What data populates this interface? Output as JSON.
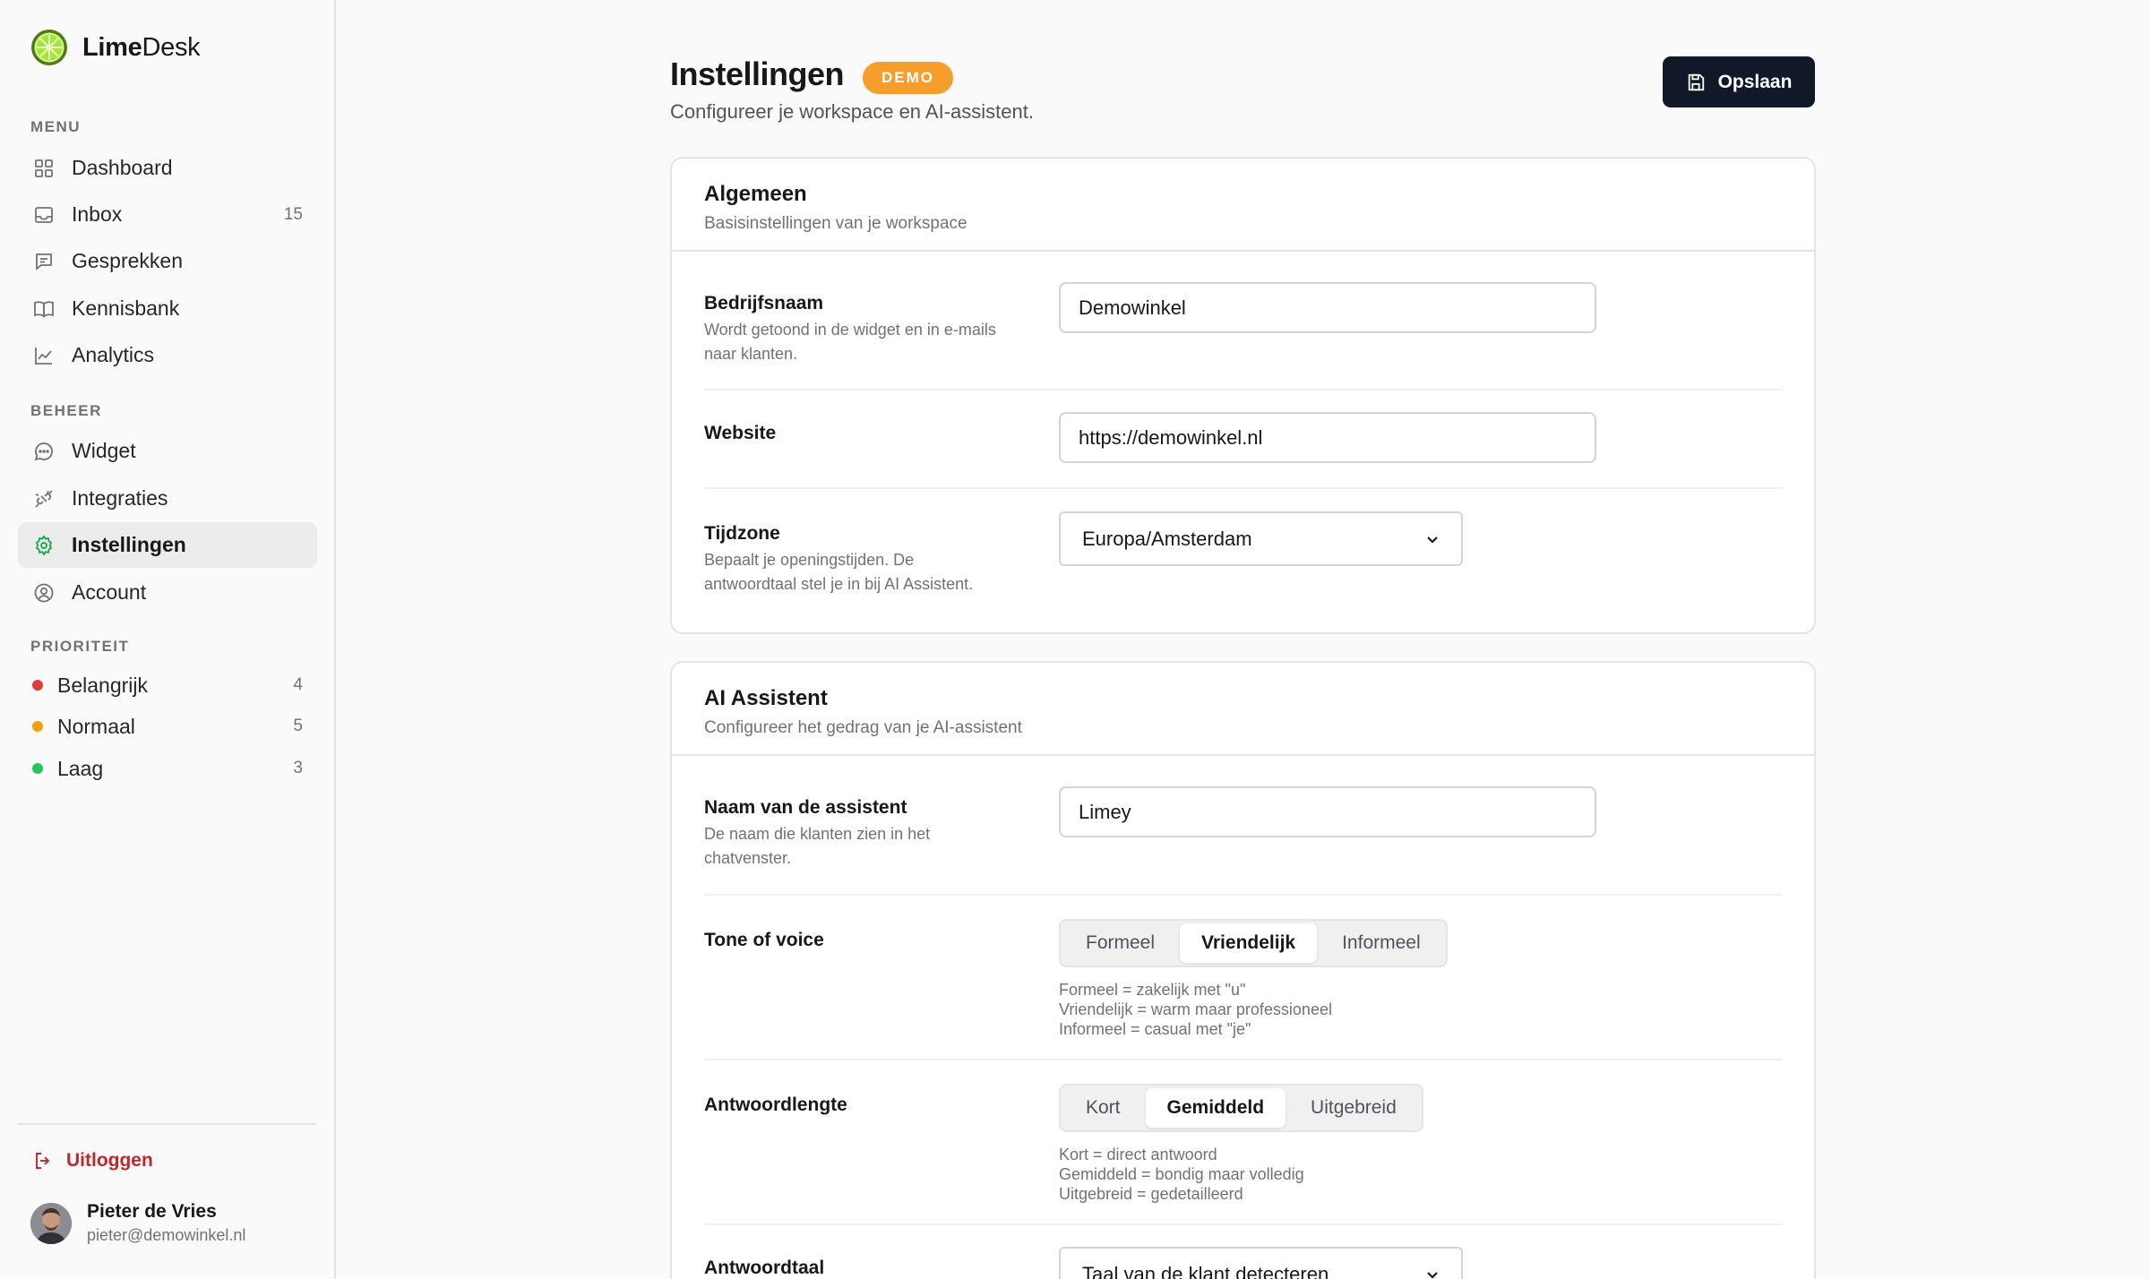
{
  "brand": {
    "name_bold": "Lime",
    "name_rest": "Desk"
  },
  "sidebar": {
    "menu_label": "MENU",
    "menu_items": [
      {
        "label": "Dashboard",
        "icon": "grid-icon",
        "count": ""
      },
      {
        "label": "Inbox",
        "icon": "inbox-icon",
        "count": "15"
      },
      {
        "label": "Gesprekken",
        "icon": "message-icon",
        "count": ""
      },
      {
        "label": "Kennisbank",
        "icon": "book-icon",
        "count": ""
      },
      {
        "label": "Analytics",
        "icon": "chart-icon",
        "count": ""
      }
    ],
    "beheer_label": "BEHEER",
    "beheer_items": [
      {
        "label": "Widget",
        "icon": "chat-bubble-icon"
      },
      {
        "label": "Integraties",
        "icon": "plug-icon"
      },
      {
        "label": "Instellingen",
        "icon": "gear-icon",
        "active": true
      },
      {
        "label": "Account",
        "icon": "user-circle-icon"
      }
    ],
    "priority_label": "PRIORITEIT",
    "priority_items": [
      {
        "label": "Belangrijk",
        "count": "4",
        "color": "#e03a3a"
      },
      {
        "label": "Normaal",
        "count": "5",
        "color": "#f59e0b"
      },
      {
        "label": "Laag",
        "count": "3",
        "color": "#22c55e"
      }
    ],
    "logout_label": "Uitloggen",
    "user": {
      "name": "Pieter de Vries",
      "email": "pieter@demowinkel.nl"
    }
  },
  "header": {
    "title": "Instellingen",
    "badge": "DEMO",
    "subtitle": "Configureer je workspace en AI-assistent.",
    "save_label": "Opslaan"
  },
  "general": {
    "title": "Algemeen",
    "description": "Basisinstellingen van je workspace",
    "company_label": "Bedrijfsnaam",
    "company_hint": "Wordt getoond in de widget en in e-mails naar klanten.",
    "company_value": "Demowinkel",
    "website_label": "Website",
    "website_value": "https://demowinkel.nl",
    "timezone_label": "Tijdzone",
    "timezone_hint": "Bepaalt je openingstijden. De antwoordtaal stel je in bij AI Assistent.",
    "timezone_value": "Europa/Amsterdam"
  },
  "assistant": {
    "title": "AI Assistent",
    "description": "Configureer het gedrag van je AI-assistent",
    "name_label": "Naam van de assistent",
    "name_hint": "De naam die klanten zien in het chatvenster.",
    "name_value": "Limey",
    "tone_label": "Tone of voice",
    "tone_options": [
      "Formeel",
      "Vriendelijk",
      "Informeel"
    ],
    "tone_selected": "Vriendelijk",
    "tone_help": [
      "Formeel = zakelijk met \"u\"",
      "Vriendelijk = warm maar professioneel",
      "Informeel = casual met \"je\""
    ],
    "length_label": "Antwoordlengte",
    "length_options": [
      "Kort",
      "Gemiddeld",
      "Uitgebreid"
    ],
    "length_selected": "Gemiddeld",
    "length_help": [
      "Kort = direct antwoord",
      "Gemiddeld = bondig maar volledig",
      "Uitgebreid = gedetailleerd"
    ],
    "language_label": "Antwoordtaal",
    "language_value": "Taal van de klant detecteren"
  },
  "colors": {
    "accent": "#84cc16",
    "primary_button": "#111827",
    "badge": "#f59e2c",
    "logout": "#c0262d"
  }
}
